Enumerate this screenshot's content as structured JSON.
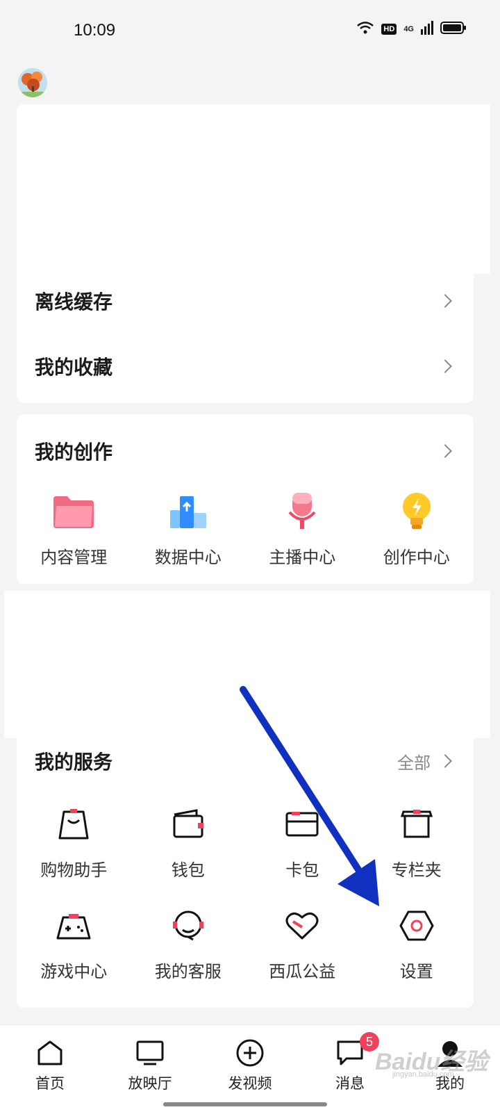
{
  "status_bar": {
    "time": "10:09",
    "hd": "HD",
    "network": "4G"
  },
  "lists": [
    {
      "label": "离线缓存"
    },
    {
      "label": "我的收藏"
    }
  ],
  "creation": {
    "title": "我的创作",
    "items": [
      {
        "label": "内容管理",
        "icon": "folder-icon"
      },
      {
        "label": "数据中心",
        "icon": "data-chart-icon"
      },
      {
        "label": "主播中心",
        "icon": "microphone-icon"
      },
      {
        "label": "创作中心",
        "icon": "lightbulb-icon"
      }
    ]
  },
  "services": {
    "title": "我的服务",
    "all_label": "全部",
    "items": [
      {
        "label": "购物助手",
        "icon": "shopping-bag-icon"
      },
      {
        "label": "钱包",
        "icon": "wallet-icon"
      },
      {
        "label": "卡包",
        "icon": "card-icon"
      },
      {
        "label": "专栏夹",
        "icon": "basket-icon"
      },
      {
        "label": "游戏中心",
        "icon": "gamepad-icon"
      },
      {
        "label": "我的客服",
        "icon": "headset-icon"
      },
      {
        "label": "西瓜公益",
        "icon": "heart-icon"
      },
      {
        "label": "设置",
        "icon": "settings-hexagon-icon"
      }
    ]
  },
  "tabbar": {
    "tabs": [
      {
        "label": "首页",
        "icon": "home-icon"
      },
      {
        "label": "放映厅",
        "icon": "tv-icon"
      },
      {
        "label": "发视频",
        "icon": "plus-circle-icon"
      },
      {
        "label": "消息",
        "icon": "message-icon",
        "badge": "5"
      },
      {
        "label": "我的",
        "icon": "profile-icon"
      }
    ]
  },
  "watermark": {
    "text": "Baidu经验",
    "sub": "jingyan.baidu.com"
  },
  "colors": {
    "accent": "#f0415a",
    "arrow": "#1030c0"
  }
}
